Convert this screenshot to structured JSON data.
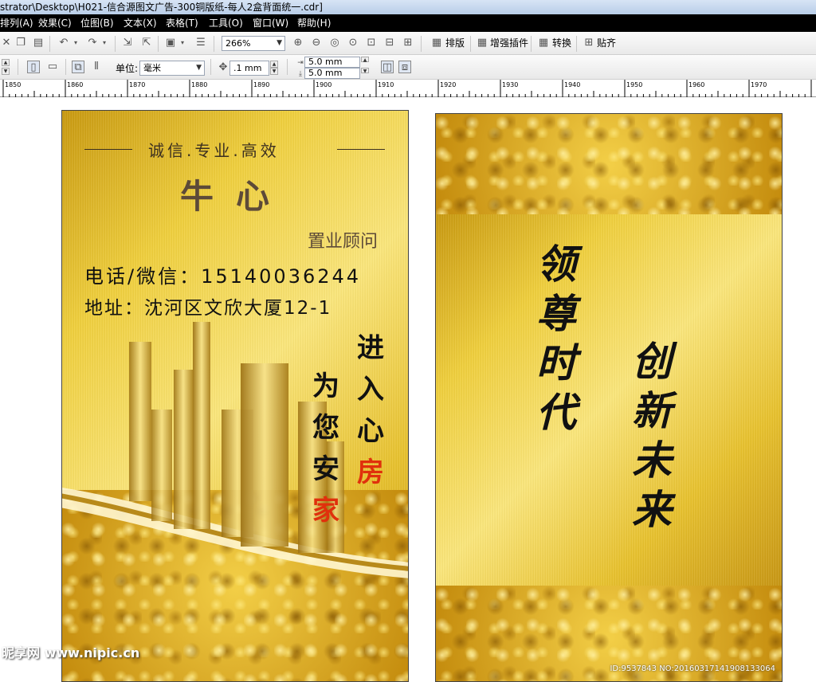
{
  "titlebar": {
    "text": "strator\\Desktop\\H021-信合源图文广告-300铜版纸-每人2盒背面统一.cdr]"
  },
  "menu": [
    "排列(A)",
    "效果(C)",
    "位图(B)",
    "文本(X)",
    "表格(T)",
    "工具(O)",
    "窗口(W)",
    "帮助(H)"
  ],
  "toolbar1": {
    "zoom": "266%",
    "plugins": [
      "排版",
      "增强插件",
      "转换",
      "贴齐"
    ]
  },
  "toolbar2": {
    "unit_label": "单位:",
    "unit_value": "毫米",
    "nudge_value": ".1 mm",
    "dup_x": "5.0 mm",
    "dup_y": "5.0 mm"
  },
  "ruler": {
    "labels": [
      "1850",
      "1860",
      "1870",
      "1880",
      "1890",
      "1900",
      "1910",
      "1920",
      "1930",
      "1940",
      "1950",
      "1960",
      "1970"
    ]
  },
  "card_front": {
    "slogan": "诚信.专业.高效",
    "name": "牛心",
    "position": "置业顾问",
    "phone": "电话/微信：15140036244",
    "address": "地址：沈河区文欣大厦12-1",
    "vertical_right": [
      "进",
      "入",
      "心",
      "房"
    ],
    "vertical_left": [
      "为",
      "您",
      "安",
      "家"
    ]
  },
  "card_back": {
    "line1": [
      "领",
      "尊",
      "时",
      "代"
    ],
    "line2": [
      "创",
      "新",
      "未",
      "来"
    ]
  },
  "watermarks": {
    "left": "昵享网 www.nipic.cn",
    "right": "ID:9537843 NO:20160317141908133064"
  },
  "colors": {
    "menubar_bg": "#000000",
    "gold": "#f0cf3b",
    "accent_red": "#e0300c"
  }
}
